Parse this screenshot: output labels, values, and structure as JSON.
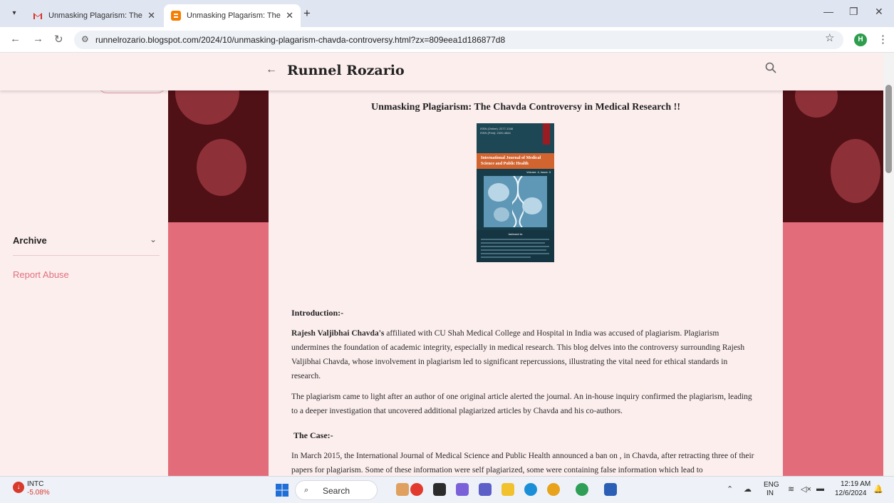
{
  "browser": {
    "tabs": [
      {
        "title": "Unmasking Plagarism: The Chav",
        "favicon": "gmail-icon",
        "active": false
      },
      {
        "title": "Unmasking Plagarism: The Cha",
        "favicon": "blogger-icon",
        "active": true
      }
    ],
    "new_tab_glyph": "+",
    "url": "runnelrozario.blogspot.com/2024/10/unmasking-plagarism-chavda-controversy.html?zx=809eea1d186877d8",
    "profile_initial": "H"
  },
  "header": {
    "blog_title": "Runnel Rozario"
  },
  "sidebar": {
    "archive_label": "Archive",
    "report_abuse_label": "Report Abuse"
  },
  "post": {
    "title": "Unmasking Plagiarism: The Chavda Controversy in Medical Research !!",
    "cover": {
      "issn": "ISSN (Online): 2277-1348\nISSN (Print): 2320-4664",
      "journal_title": "International Journal of Medical Science and Public Health",
      "volume": "Volume: 4, Issue: 3",
      "indexed_in": "Indexed in"
    },
    "intro_heading": "Introduction:-",
    "intro_p1_bold": "Rajesh Valjibhai Chavda's",
    "intro_p1_rest": " affiliated with CU Shah Medical College and Hospital in India was accused of plagiarism. Plagiarism undermines the foundation of academic integrity, especially in medical research. This blog delves into the controversy surrounding Rajesh Valjibhai Chavda, whose involvement in plagiarism led to significant repercussions, illustrating the vital need for ethical standards in research.",
    "intro_p2": "The plagiarism came to light after an author of one original article alerted the journal. An in-house inquiry confirmed the plagiarism, leading to a deeper investigation that uncovered additional plagiarized articles by Chavda and his co-authors.",
    "case_heading": "The Case:-",
    "case_p1": "In March 2015, the International Journal of Medical Science and Public Health announced a ban on , in Chavda, after retracting three of their papers for plagiarism. Some of these information were self plagiarized, some were containing false information which lead to"
  },
  "taskbar": {
    "stock_symbol": "INTC",
    "stock_change": "-5.08%",
    "search_label": "Search",
    "lang_top": "ENG",
    "lang_bottom": "IN",
    "time": "12:19 AM",
    "date": "12/6/2024"
  },
  "colors": {
    "page_bg": "#fdeeee",
    "banner_dark": "#4f1016",
    "banner_pink": "#e36c7a",
    "link_pink": "#e0707e"
  }
}
